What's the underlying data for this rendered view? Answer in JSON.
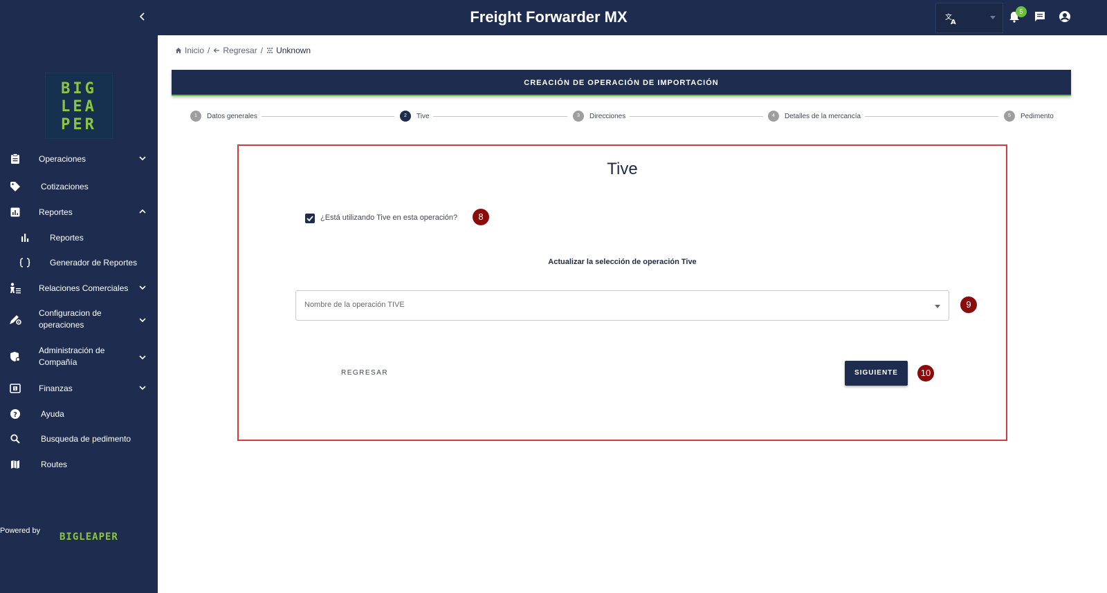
{
  "sidebar": {
    "logo_lines": "BIG\nLEA\nPER",
    "items": [
      {
        "label": "Operaciones",
        "icon": "clipboard-icon",
        "chevron": "down"
      },
      {
        "label": "Cotizaciones",
        "icon": "tag-icon"
      },
      {
        "label": "Reportes",
        "icon": "report-icon",
        "chevron": "up"
      },
      {
        "label": "Reportes",
        "icon": "bar-chart-icon",
        "sub": true
      },
      {
        "label": "Generador de Reportes",
        "icon": "braces-icon",
        "sub": true
      },
      {
        "label": "Relaciones Comerciales",
        "icon": "person-list-icon",
        "chevron": "down"
      },
      {
        "label": "Configuracion de operaciones",
        "icon": "settings-edit-icon",
        "chevron": "down"
      },
      {
        "label": "Administración de Compañía",
        "icon": "shield-settings-icon",
        "chevron": "down"
      },
      {
        "label": "Finanzas",
        "icon": "money-icon",
        "chevron": "down"
      },
      {
        "label": "Ayuda",
        "icon": "help-icon"
      },
      {
        "label": "Busqueda de pedimento",
        "icon": "search-icon"
      },
      {
        "label": "Routes",
        "icon": "map-icon"
      }
    ],
    "powered_by": "Powered by",
    "powered_logo": "BIGLEAPER"
  },
  "topbar": {
    "title": "Freight Forwarder MX",
    "notification_count": "5"
  },
  "breadcrumb": {
    "home": "Inicio",
    "back": "Regresar",
    "current": "Unknown"
  },
  "banner": {
    "title": "CREACIÓN DE OPERACIÓN DE IMPORTACIÓN"
  },
  "stepper": {
    "steps": [
      {
        "num": "1",
        "label": "Datos generales"
      },
      {
        "num": "2",
        "label": "Tive"
      },
      {
        "num": "3",
        "label": "Direcciones"
      },
      {
        "num": "4",
        "label": "Detalles de la mercancía"
      },
      {
        "num": "5",
        "label": "Pedimento"
      }
    ],
    "active_index": 1
  },
  "card": {
    "title": "Tive",
    "checkbox_label": "¿Está utilizando Tive en esta operación?",
    "checkbox_checked": true,
    "section_label": "Actualizar la selección de operación Tive",
    "select_placeholder": "Nombre de la operación TIVE",
    "back_label": "REGRESAR",
    "next_label": "SIGUIENTE",
    "markers": [
      "8",
      "9",
      "10"
    ]
  },
  "colors": {
    "primary": "#1e2d4f",
    "accent_green": "#6cbf3c",
    "marker_red": "#8b0b0b",
    "card_border": "#d33a3a"
  }
}
